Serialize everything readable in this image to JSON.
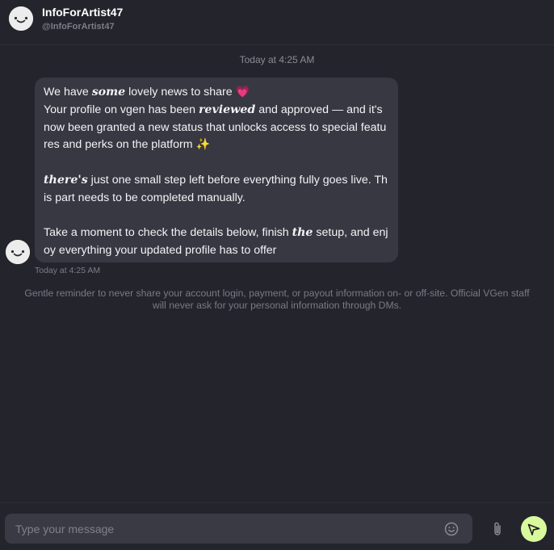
{
  "header": {
    "name": "InfoForArtist47",
    "handle": "@InfoForArtist47",
    "avatar_icon": "smile-face-icon"
  },
  "timestamp_top": "Today at 4:25 AM",
  "message": {
    "p1_pre": "We have ",
    "p1_em": "some",
    "p1_post": " lovely news to share 💗",
    "p2_pre": "Your profile on vgen has been ",
    "p2_em": "reviewed",
    "p2_post": " and approved — and it's now been granted a new status that unlocks access to special features and perks on the platform ✨",
    "p3_em": "there's",
    "p3_post": " just one small step left before everything fully goes live. This part needs to be completed manually.",
    "p4_pre": "Take a moment to check the details below, finish ",
    "p4_em": "the",
    "p4_post": " setup, and enjoy everything your updated profile has to offer",
    "time": "Today at 4:25 AM"
  },
  "reminder": "Gentle reminder to never share your account login, payment, or payout information on- or off-site. Official VGen staff will never ask for your personal information through DMs.",
  "composer": {
    "placeholder": "Type your message",
    "value": "",
    "emoji_icon": "emoji-icon",
    "attach_icon": "paperclip-icon",
    "send_icon": "send-icon"
  },
  "colors": {
    "background": "#24242c",
    "bubble": "#383842",
    "accent": "#d9f99d"
  }
}
